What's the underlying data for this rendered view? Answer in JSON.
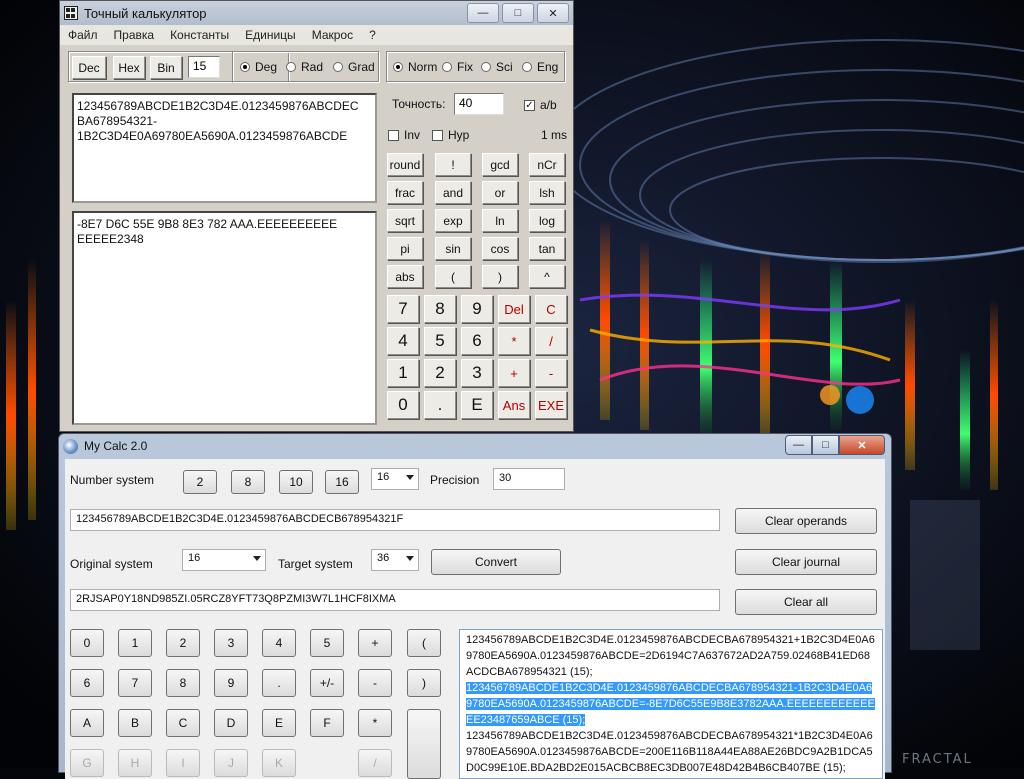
{
  "colors": {
    "desktop_bg": "#05060a",
    "selection": "#3399ff",
    "error_red": "#b40000"
  },
  "wallpaper": {
    "watermark": "FRACTAL"
  },
  "win1": {
    "title": "Точный калькулятор",
    "controls": {
      "minimize": "—",
      "maximize": "□",
      "close": "✕"
    },
    "menu": [
      "Файл",
      "Правка",
      "Константы",
      "Единицы",
      "Макрос",
      "?"
    ],
    "base": {
      "dec": "Dec",
      "hex": "Hex",
      "bin": "Bin",
      "digits": "15"
    },
    "angle": {
      "deg": "Deg",
      "rad": "Rad",
      "grad": "Grad",
      "selected": "Deg"
    },
    "format": {
      "norm": "Norm",
      "fix": "Fix",
      "sci": "Sci",
      "eng": "Eng",
      "selected": "Norm"
    },
    "precision_label": "Точность:",
    "precision_value": "40",
    "ab_label": "a/b",
    "ab_checked": true,
    "inv_label": "Inv",
    "hyp_label": "Hyp",
    "time": "1 ms",
    "input_text": "123456789ABCDE1B2C3D4E.0123459876ABCDEC\nBA678954321-\n1B2C3D4E0A69780EA5690A.0123459876ABCDE",
    "output_text": "-8E7 D6C 55E 9B8 8E3 782 AAA.EEEEEEEEEE\nEEEEE2348",
    "func": [
      "round",
      "!",
      "gcd",
      "nCr",
      "frac",
      "and",
      "or",
      "lsh",
      "sqrt",
      "exp",
      "ln",
      "log",
      "pi",
      "sin",
      "cos",
      "tan",
      "abs",
      "(",
      ")",
      "^"
    ],
    "keys": [
      "7",
      "8",
      "9",
      "Del",
      "C",
      "4",
      "5",
      "6",
      "*",
      "/",
      "1",
      "2",
      "3",
      "+",
      "-",
      "0",
      ".",
      "E",
      "Ans",
      "EXE"
    ]
  },
  "win2": {
    "title": "My Calc 2.0",
    "controls": {
      "minimize": "—",
      "maximize": "□",
      "close": "✕"
    },
    "number_system_label": "Number system",
    "ns_buttons": [
      "2",
      "8",
      "10",
      "16"
    ],
    "ns_value": "16",
    "precision_label": "Precision",
    "precision_value": "30",
    "operand": "123456789ABCDE1B2C3D4E.0123459876ABCDECB678954321F",
    "clear_operands": "Clear operands",
    "original_label": "Original system",
    "original_value": "16",
    "target_label": "Target system",
    "target_value": "36",
    "convert": "Convert",
    "clear_journal": "Clear journal",
    "result": "2RJSAP0Y18ND985ZI.05RCZ8YFT73Q8PZMI3W7L1HCF8IXMA",
    "clear_all": "Clear all",
    "keypad": [
      "0",
      "1",
      "2",
      "3",
      "4",
      "5",
      "+",
      "(",
      "6",
      "7",
      "8",
      "9",
      ".",
      "+/-",
      "-",
      ")",
      "A",
      "B",
      "C",
      "D",
      "E",
      "F",
      "*",
      "",
      "G",
      "H",
      "I",
      "J",
      "K",
      "",
      "/",
      ""
    ],
    "journal": [
      {
        "text": "123456789ABCDE1B2C3D4E.0123459876ABCDECBA678954321+1B2C3D4E0A69780EA5690A.0123459876ABCDE=2D6194C7A637672AD2A759.02468B41ED68ACDCBA678954321 (15);",
        "selected": false
      },
      {
        "text": "123456789ABCDE1B2C3D4E.0123459876ABCDECBA678954321-1B2C3D4E0A69780EA5690A.0123459876ABCDE=-8E7D6C55E9B8E3782AAA.EEEEEEEEEEEEEE23487659ABCE (15);",
        "selected": true
      },
      {
        "text": "123456789ABCDE1B2C3D4E.0123459876ABCDECBA678954321*1B2C3D4E0A69780EA5690A.0123459876ABCDE=200E116B118A44EA88AE26BDC9A2B1DCA5D0C99E10E.BDA2BD2E015ACBCB8EC3DB007E48D42B4B6CB407BE (15);",
        "selected": false
      }
    ]
  }
}
